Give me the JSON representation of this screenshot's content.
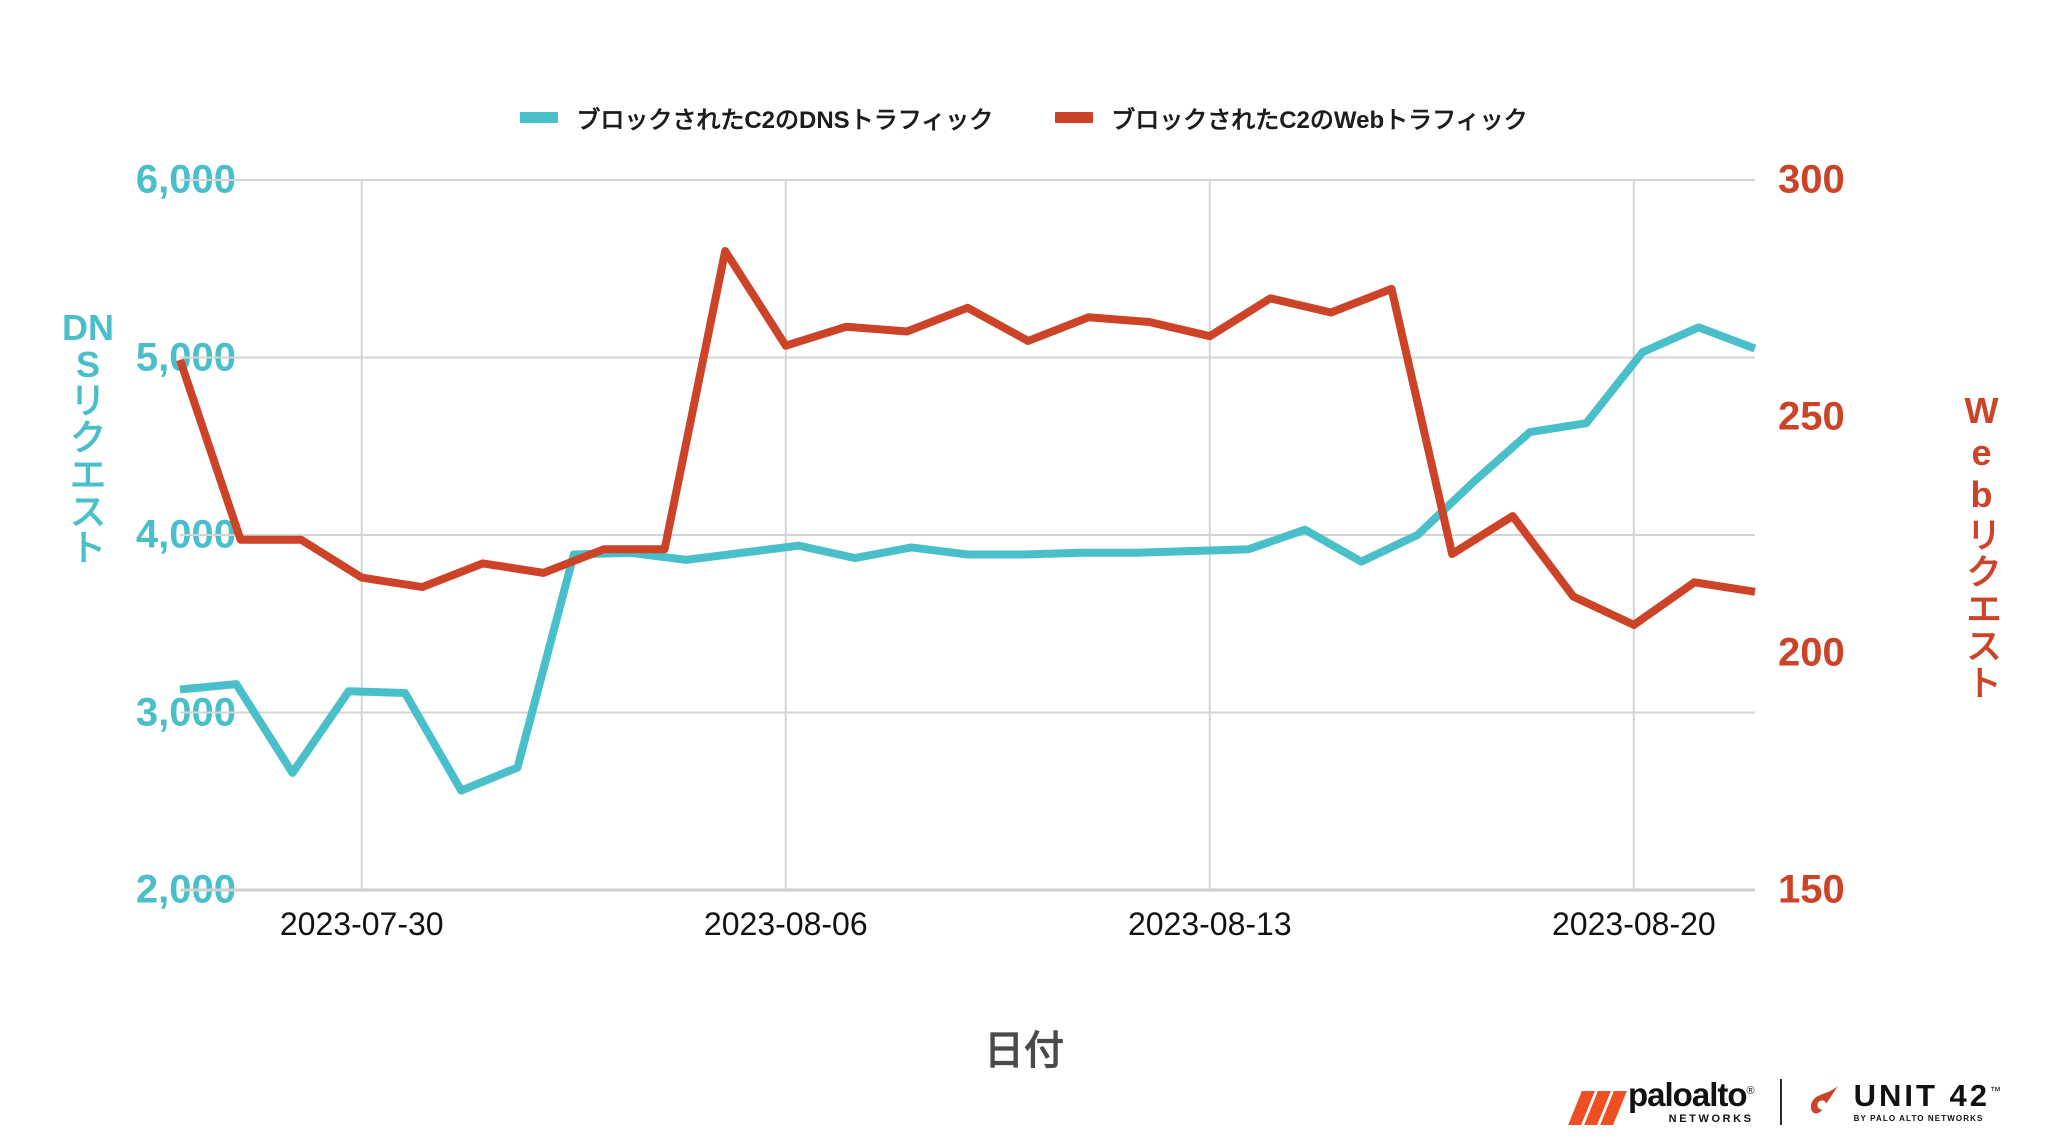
{
  "legend": {
    "items": [
      {
        "label": "ブロックされたC2のDNSトラフィック",
        "color": "#49BFC9",
        "icon": "line-swatch-icon"
      },
      {
        "label": "ブロックされたC2のWebトラフィック",
        "color": "#CC4328",
        "icon": "line-swatch-icon"
      }
    ]
  },
  "axes": {
    "left_title": "DNSリクエスト",
    "right_title_latin": "Web",
    "right_title_jp": "リクエスト",
    "right_title": "Webリクエスト",
    "x_title": "日付",
    "left_ticks": [
      "6,000",
      "5,000",
      "4,000",
      "3,000",
      "2,000"
    ],
    "right_ticks": [
      "300",
      "250",
      "200",
      "150"
    ],
    "x_ticks": [
      "2023-07-30",
      "2023-08-06",
      "2023-08-13",
      "2023-08-20"
    ]
  },
  "footer": {
    "paloalto_name": "paloalto",
    "paloalto_reg": "®",
    "paloalto_sub": "NETWORKS",
    "unit_name": "UNIT 42",
    "unit_tm": "™",
    "unit_sub": "BY PALO ALTO NETWORKS"
  },
  "colors": {
    "dns": "#49BFC9",
    "web": "#CC4328",
    "grid": "#d4d4d4",
    "text": "#111111",
    "axis_title": "#4a4a4a"
  },
  "chart_data": {
    "type": "line",
    "title": "",
    "xlabel": "日付",
    "grid": true,
    "legend_position": "top-center",
    "x": [
      "2023-07-27",
      "2023-07-28",
      "2023-07-29",
      "2023-07-30",
      "2023-07-31",
      "2023-08-01",
      "2023-08-02",
      "2023-08-03",
      "2023-08-04",
      "2023-08-05",
      "2023-08-06",
      "2023-08-07",
      "2023-08-08",
      "2023-08-09",
      "2023-08-10",
      "2023-08-11",
      "2023-08-12",
      "2023-08-13",
      "2023-08-14",
      "2023-08-15",
      "2023-08-16",
      "2023-08-17",
      "2023-08-18",
      "2023-08-19",
      "2023-08-20",
      "2023-08-21",
      "2023-08-22"
    ],
    "x_tick_labels": [
      "2023-07-30",
      "2023-08-06",
      "2023-08-13",
      "2023-08-20"
    ],
    "x_tick_indices": [
      3,
      10,
      17,
      24
    ],
    "series": [
      {
        "name": "ブロックされたC2のDNSトラフィック",
        "axis": "left",
        "color": "#49BFC9",
        "ylabel": "DNSリクエスト",
        "ylim": [
          2000,
          6000
        ],
        "yticks": [
          2000,
          3000,
          4000,
          5000,
          6000
        ],
        "values": [
          3130,
          3160,
          2660,
          3120,
          3110,
          2560,
          2690,
          3890,
          3900,
          3860,
          3900,
          3940,
          3870,
          3930,
          3890,
          3890,
          3900,
          3900,
          3910,
          3920,
          4030,
          3850,
          4000,
          4300,
          4580,
          4630,
          5030
        ],
        "values_tail": [
          5170,
          5050
        ]
      },
      {
        "name": "ブロックされたC2のWebトラフィック",
        "axis": "right",
        "color": "#CC4328",
        "ylabel": "Webリクエスト",
        "ylim": [
          150,
          300
        ],
        "yticks": [
          150,
          200,
          250,
          300
        ],
        "values": [
          262,
          224,
          224,
          216,
          214,
          219,
          217,
          222,
          222,
          285,
          265,
          269,
          268,
          273,
          266,
          271,
          270,
          267,
          275,
          272,
          277,
          221,
          229,
          212,
          206,
          215,
          213
        ]
      }
    ]
  }
}
